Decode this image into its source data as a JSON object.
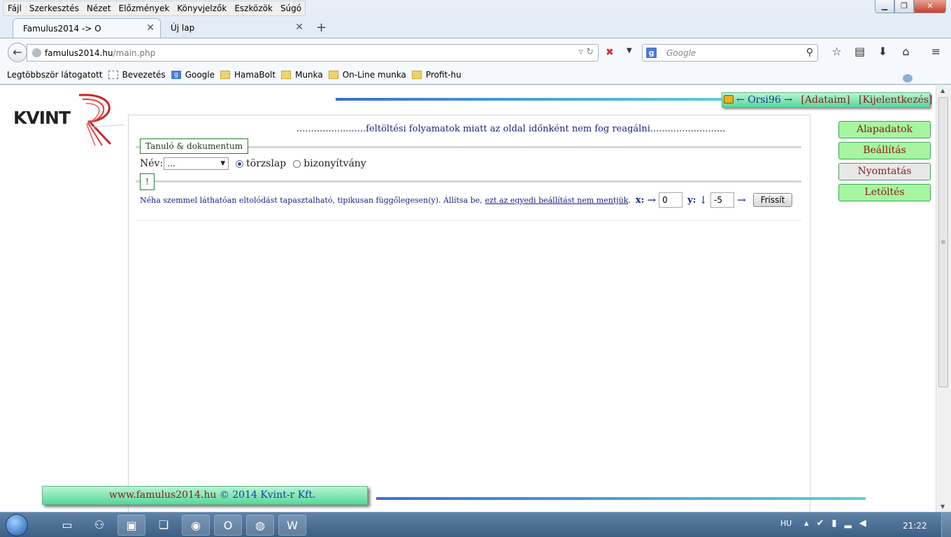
{
  "browser": {
    "menu": [
      "Fájl",
      "Szerkesztés",
      "Nézet",
      "Előzmények",
      "Könyvjelzők",
      "Eszközök",
      "Súgó"
    ],
    "window_controls": [
      "minimize-icon",
      "maximize-icon",
      "close-icon"
    ],
    "tabs": [
      {
        "title": "Famulus2014 -> O",
        "active": true
      },
      {
        "title": "Új lap",
        "active": false
      }
    ],
    "url_host": "famulus2014.hu",
    "url_path": "/main.php",
    "search_placeholder": "Google",
    "search_engine_letter": "g",
    "bookmarks": [
      {
        "label": "Legtöbbször látogatott",
        "icon": "history-icon"
      },
      {
        "label": "Bevezetés",
        "icon": "page-icon"
      },
      {
        "label": "Google",
        "icon": "google-icon"
      },
      {
        "label": "HamaBolt",
        "icon": "folder-icon"
      },
      {
        "label": "Munka",
        "icon": "folder-icon"
      },
      {
        "label": "On-Line munka",
        "icon": "folder-icon"
      },
      {
        "label": "Profit-hu",
        "icon": "folder-icon"
      }
    ]
  },
  "page": {
    "logo_text": "KVINT",
    "userbar": {
      "arrow_left": "←",
      "username": "Orsi96",
      "arrow_right": "→",
      "profile_link": "[Adataim]",
      "logout_link": "[Kijelentkezés]"
    },
    "notice": "........................feltöltési folyamatok miatt az oldal időnként nem fog reagálni..........................",
    "section1": {
      "legend": "Tanuló & dokumentum",
      "name_label": "Név:",
      "name_select_value": "...",
      "radio1_label": "törzslap",
      "radio2_label": "bizonyítvány",
      "radio_selected": "törzslap"
    },
    "section2": {
      "legend": "!",
      "info_text": "Néha szemmel láthatóan eltolódást tapasztalható, tipikusan függőlegesen(y). Állítsa be,",
      "info_link": "ezt az egyedi beállítást nem mentjük",
      "info_end": ".",
      "x_label": "x:",
      "x_arrow": "→",
      "x_value": "0",
      "y_label": "y:",
      "y_arrow": "↓",
      "y_value": "-5",
      "refresh_arrow": "→",
      "refresh_button": "Frissít"
    },
    "side_buttons": [
      {
        "label": "Alapadatok",
        "state": "green"
      },
      {
        "label": "Beállítás",
        "state": "green"
      },
      {
        "label": "Nyomtatás",
        "state": "gray"
      },
      {
        "label": "Letöltés",
        "state": "green"
      }
    ],
    "footer": {
      "site": "www.famulus2014.hu",
      "copyright": "© 2014 Kvint-r Kft."
    }
  },
  "taskbar": {
    "apps": [
      "explorer-icon",
      "network-icon",
      "save-icon",
      "folder-sync-icon",
      "chrome-icon",
      "outlook-icon",
      "firefox-icon",
      "word-icon"
    ],
    "language": "HU",
    "clock": "21:22"
  }
}
